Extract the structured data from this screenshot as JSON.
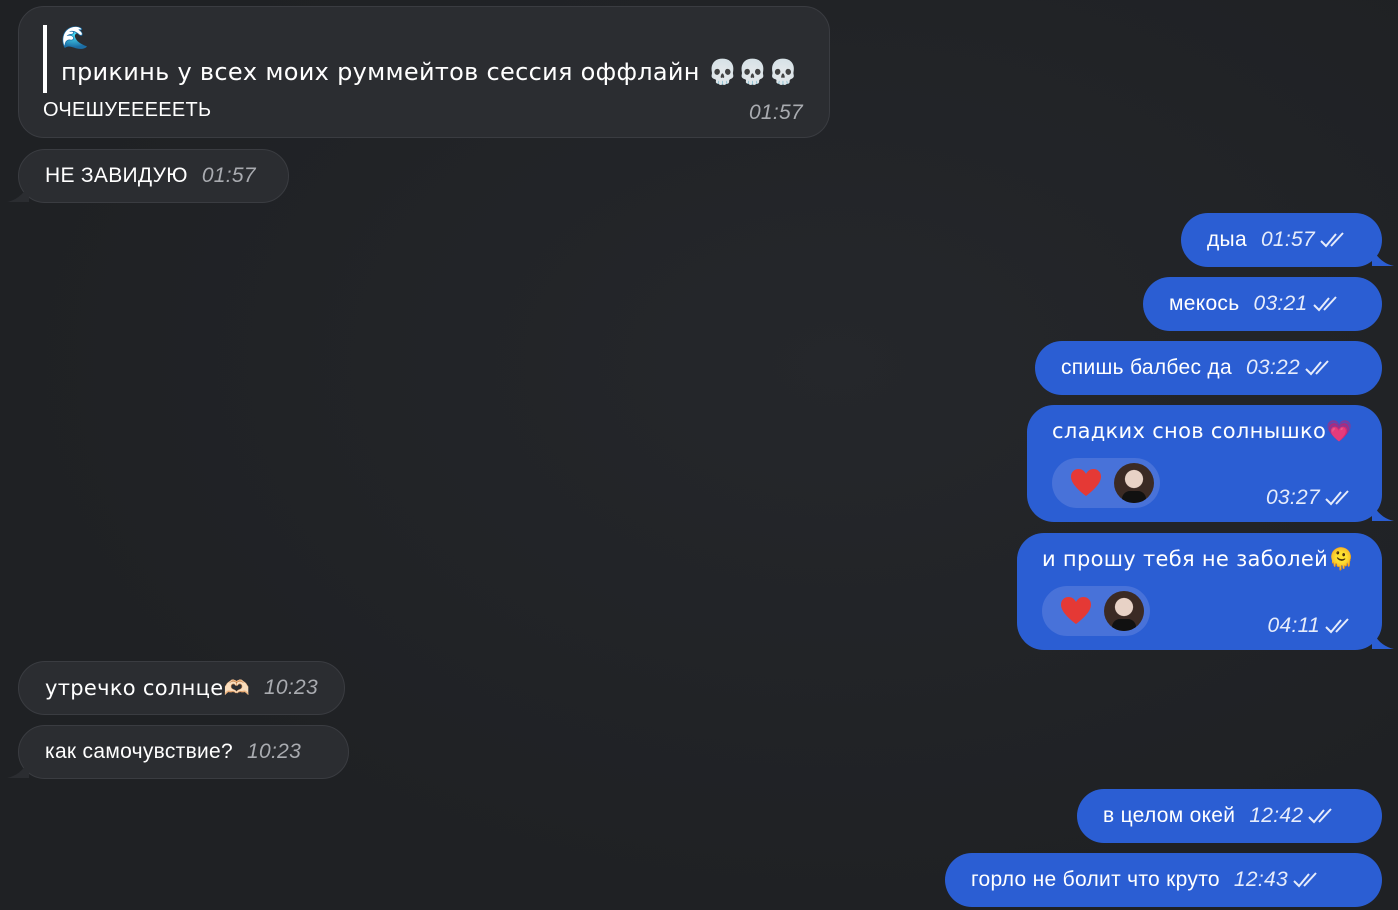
{
  "messages": {
    "m1": {
      "reply_emoji": "🌊",
      "reply_text": "прикинь у всех моих руммейтов сессия оффлайн 💀💀💀",
      "text": "ОЧЕШУЕЕЕЕЕТЬ",
      "time": "01:57"
    },
    "m2": {
      "text": "НЕ ЗАВИДУЮ",
      "time": "01:57"
    },
    "m3": {
      "text": "дыа",
      "time": "01:57"
    },
    "m4": {
      "text": "мекось",
      "time": "03:21"
    },
    "m5": {
      "text": "спишь балбес да",
      "time": "03:22"
    },
    "m6": {
      "text": "сладких снов солнышко💗",
      "time": "03:27",
      "reaction": "heart-icon"
    },
    "m7": {
      "text": "и прошу тебя не заболей🫠",
      "time": "04:11",
      "reaction": "heart-icon"
    },
    "m8": {
      "text": "утречко солнце🫶🏻",
      "time": "10:23"
    },
    "m9": {
      "text": "как самочувствие?",
      "time": "10:23"
    },
    "m10": {
      "text": "в целом окей",
      "time": "12:42"
    },
    "m11": {
      "text": "горло не болит что круто",
      "time": "12:43"
    }
  },
  "colors": {
    "background": "#212326",
    "incoming_bubble": "#2b2d31",
    "outgoing_bubble": "#2b5ed3",
    "reaction_pill": "#4872d9",
    "heart": "#e53935"
  }
}
